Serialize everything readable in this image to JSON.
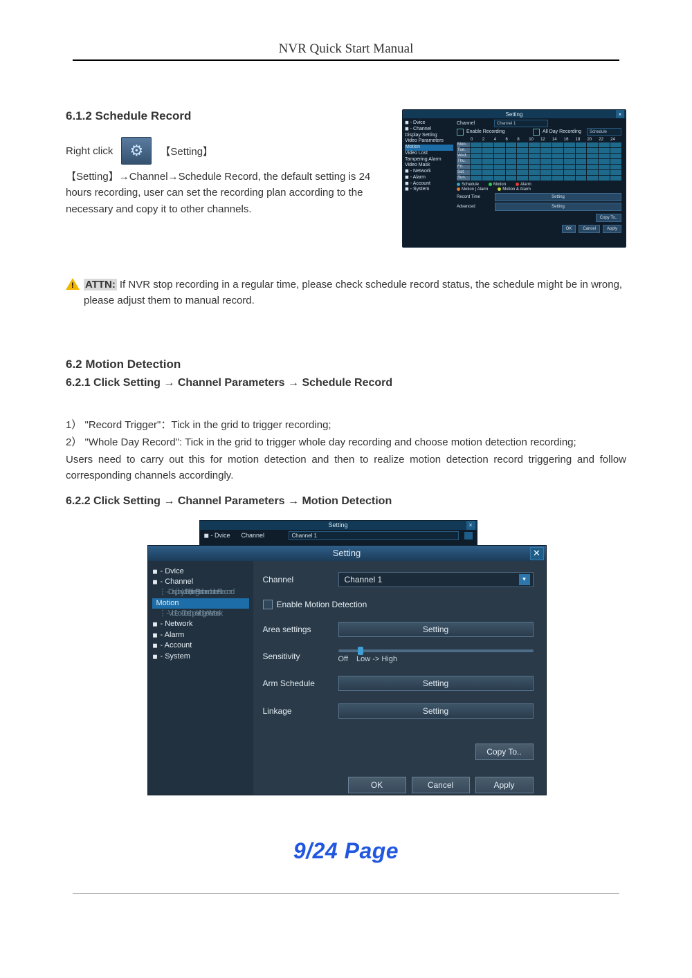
{
  "header": "NVR Quick Start Manual",
  "s612": {
    "title": "6.1.2 Schedule Record",
    "right_click": "Right click",
    "setting_bracket": "【Setting】",
    "para": "【Setting】→Channel→Schedule Record, the default setting is 24 hours recording, user can set the recording plan according to the necessary and copy it to other channels.",
    "attn_label": "ATTN:",
    "attn_text": "If NVR stop recording in a regular time, please check schedule record status, the schedule might be in wrong, please adjust them to manual record."
  },
  "shotA": {
    "title": "Setting",
    "tree": [
      "◼ - Dvice",
      "◼ - Channel",
      "  Display Setting",
      "  Video Parameters",
      "  Motion",
      "  Video Lost",
      "  Tampering Alarm",
      "  Video Mask",
      "◼ - Network",
      "◼ - Alarm",
      "◼ - Account",
      "◼ - System"
    ],
    "tree_sel_index": 4,
    "channel_label": "Channel",
    "channel_value": "Channel 1",
    "enable_label": "Enable Recording",
    "allday_label": "All Day Recording",
    "schedule_label": "Schedule",
    "hours": [
      "0",
      "2",
      "4",
      "6",
      "8",
      "10",
      "12",
      "14",
      "16",
      "18",
      "20",
      "22",
      "24"
    ],
    "days": [
      "Mon.",
      "Tue.",
      "Wed.",
      "Thu.",
      "Fri.",
      "Sat.",
      "Sun."
    ],
    "legend": [
      {
        "color": "#2fa4bf",
        "label": "Schedule"
      },
      {
        "color": "#2fcf4a",
        "label": "Motion"
      },
      {
        "color": "#e03a2f",
        "label": "Alarm"
      },
      {
        "color": "#e07b2f",
        "label": "Motion | Alarm"
      },
      {
        "color": "#c7d62f",
        "label": "Motion & Alarm"
      }
    ],
    "record_time": "Record Time",
    "advanced": "Advanced",
    "setting_btn": "Setting",
    "copy_to": "Copy To..",
    "ok": "OK",
    "cancel": "Cancel",
    "apply": "Apply"
  },
  "s62": {
    "title": "6.2 Motion Detection"
  },
  "s621": {
    "title": "6.2.1 Click Setting → Channel Parameters → Schedule Record",
    "p1": "1） \"Record Trigger\"：Tick in the grid to trigger recording;",
    "p2": "2） \"Whole Day Record\":  Tick in the grid to trigger whole day recording and choose motion detection recording;",
    "p3": "Users need to carry out this for motion detection and then to realize motion detection record triggering and follow corresponding channels accordingly."
  },
  "s622": {
    "title": "6.2.2 Click Setting → Channel Parameters → Motion Detection"
  },
  "shotB_ghost": {
    "title": "Setting",
    "tree0": "◼ - Dvice",
    "tree1": "◼ - Channel",
    "channel_label": "Channel",
    "channel_value": "Channel 1"
  },
  "shotB": {
    "title": "Setting",
    "tree": [
      {
        "t": "◼",
        "lab": "Dvice",
        "cls": ""
      },
      {
        "t": "◼",
        "lab": "Channel",
        "cls": ""
      },
      {
        "t": "",
        "lab": "Display Setting",
        "cls": "ind1 dots"
      },
      {
        "t": "",
        "lab": "Video Parameters",
        "cls": "ind1 dots"
      },
      {
        "t": "",
        "lab": "Schedule Record",
        "cls": "ind1 dots"
      },
      {
        "t": "",
        "lab": "Motion",
        "cls": "ind1 sel"
      },
      {
        "t": "",
        "lab": "Video Lost",
        "cls": "ind1 dots"
      },
      {
        "t": "",
        "lab": "Tampering Alarm",
        "cls": "ind1 dots"
      },
      {
        "t": "",
        "lab": "Video Mask",
        "cls": "ind1 dots"
      },
      {
        "t": "◼",
        "lab": "Network",
        "cls": ""
      },
      {
        "t": "◼",
        "lab": "Alarm",
        "cls": ""
      },
      {
        "t": "◼",
        "lab": "Account",
        "cls": ""
      },
      {
        "t": "◼",
        "lab": "System",
        "cls": ""
      }
    ],
    "channel_label": "Channel",
    "channel_value": "Channel 1",
    "enable_motion": "Enable Motion Detection",
    "area_label": "Area settings",
    "sensitivity_label": "Sensitivity",
    "off": "Off",
    "lowhigh": "Low -> High",
    "arm_label": "Arm Schedule",
    "linkage_label": "Linkage",
    "setting_btn": "Setting",
    "copy_to": "Copy To..",
    "ok": "OK",
    "cancel": "Cancel",
    "apply": "Apply"
  },
  "page_footer": "9/24   Page"
}
